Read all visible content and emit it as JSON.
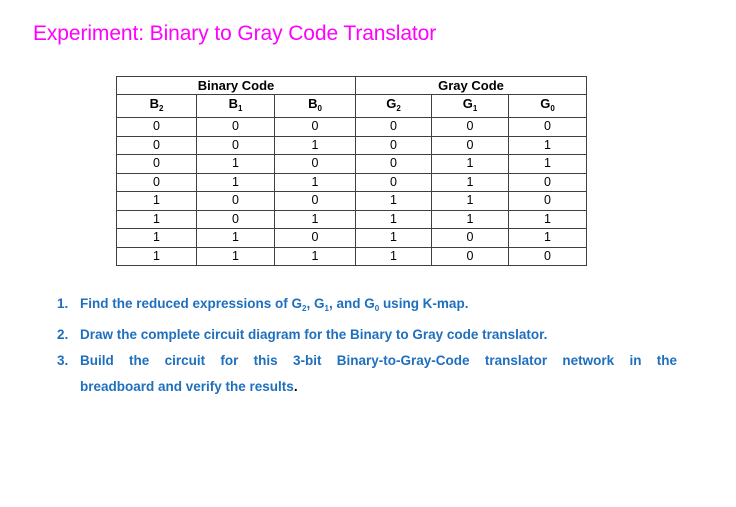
{
  "title": "Experiment: Binary to Gray Code Translator",
  "table": {
    "group_headers": [
      "Binary Code",
      "Gray Code"
    ],
    "columns": [
      {
        "letter": "B",
        "sub": "2"
      },
      {
        "letter": "B",
        "sub": "1"
      },
      {
        "letter": "B",
        "sub": "0"
      },
      {
        "letter": "G",
        "sub": "2"
      },
      {
        "letter": "G",
        "sub": "1"
      },
      {
        "letter": "G",
        "sub": "0"
      }
    ],
    "rows": [
      [
        "0",
        "0",
        "0",
        "0",
        "0",
        "0"
      ],
      [
        "0",
        "0",
        "1",
        "0",
        "0",
        "1"
      ],
      [
        "0",
        "1",
        "0",
        "0",
        "1",
        "1"
      ],
      [
        "0",
        "1",
        "1",
        "0",
        "1",
        "0"
      ],
      [
        "1",
        "0",
        "0",
        "1",
        "1",
        "0"
      ],
      [
        "1",
        "0",
        "1",
        "1",
        "1",
        "1"
      ],
      [
        "1",
        "1",
        "0",
        "1",
        "0",
        "1"
      ],
      [
        "1",
        "1",
        "1",
        "1",
        "0",
        "0"
      ]
    ]
  },
  "tasks": [
    {
      "num": "1.",
      "parts": [
        "Find the reduced expressions of G",
        "2",
        ", G",
        "1",
        ", and G",
        "0",
        " using K-map."
      ]
    },
    {
      "num": "2.",
      "text": "Draw the complete circuit diagram for the Binary to Gray code translator."
    },
    {
      "num": "3.",
      "line1": "Build the circuit for this 3-bit Binary-to-Gray-Code translator network in the",
      "line2": "breadboard and verify the results",
      "line2_end": "."
    }
  ],
  "colors": {
    "title": "#ff00ff",
    "tasks": "#1f6fbf"
  }
}
